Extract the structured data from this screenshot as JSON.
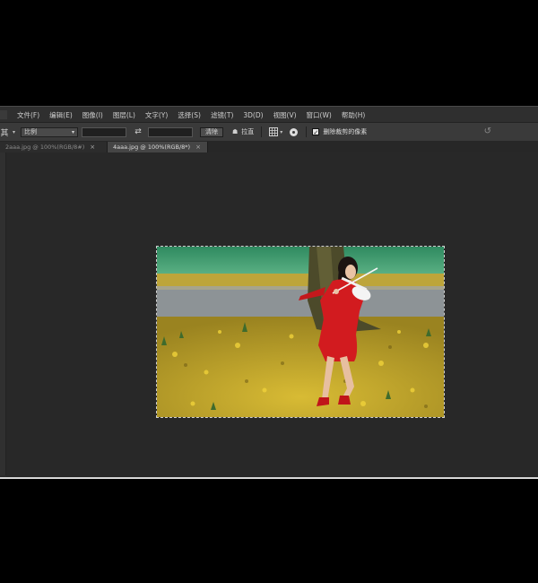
{
  "menu": [
    "文件(F)",
    "编辑(E)",
    "图像(I)",
    "图层(L)",
    "文字(Y)",
    "选择(S)",
    "滤镜(T)",
    "3D(D)",
    "视图(V)",
    "窗口(W)",
    "帮助(H)"
  ],
  "options_bar": {
    "tool_glyph": "其",
    "ratio_select": "比例",
    "swap_glyph": "⇄",
    "clear_button": "清除",
    "straighten_prefix": "☗",
    "straighten_label": "拉直",
    "delete_cropped_checked": true,
    "delete_cropped_label": "删除裁剪的像素"
  },
  "tabs": [
    {
      "label": "2aaa.jpg @ 100%(RGB/8#)",
      "active": false
    },
    {
      "label": "4aaa.jpg @ 100%(RGB/8*)",
      "active": true
    }
  ],
  "icons": {
    "tool": "crop-tool-icon",
    "swap": "swap-arrows-icon",
    "straighten": "straighten-icon",
    "overlay": "grid-overlay-icon",
    "settings": "crop-settings-icon",
    "reset": "reset-icon",
    "close": "×"
  },
  "colors": {
    "window_bg": "#2b2b2b",
    "bar_bg": "#3a3a3a",
    "dress": "#d21b1f",
    "leaves": "#c9a928",
    "grass": "#4a9c6a"
  }
}
